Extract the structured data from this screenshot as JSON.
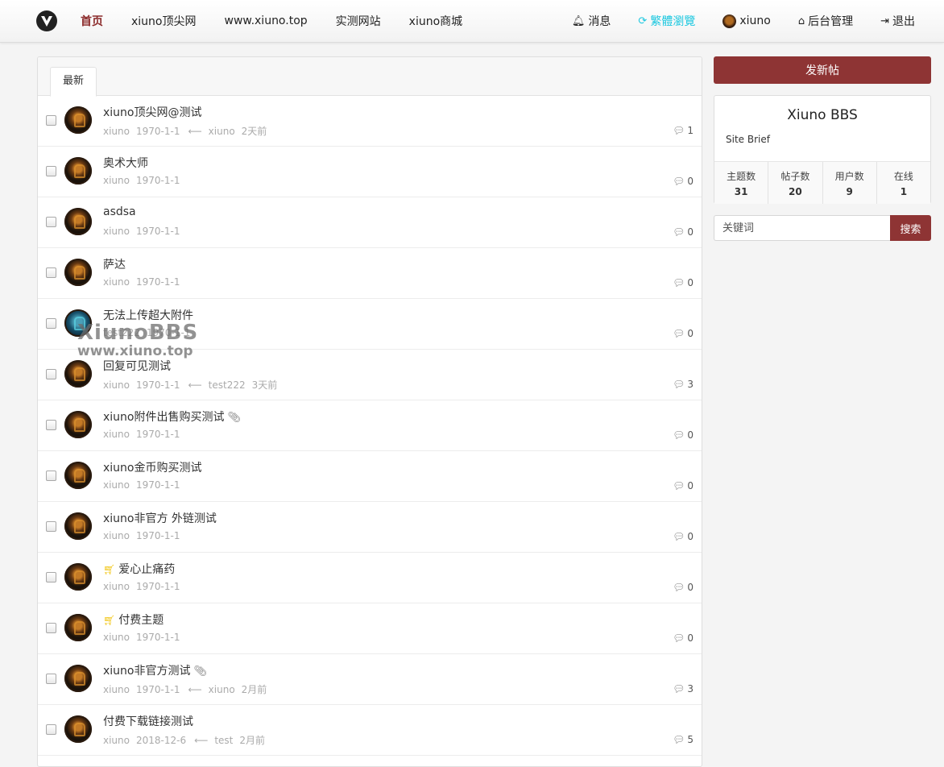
{
  "nav": {
    "left": [
      {
        "label": "首页",
        "active": true
      },
      {
        "label": "xiuno顶尖网"
      },
      {
        "label": "www.xiuno.top"
      },
      {
        "label": "实测网站"
      },
      {
        "label": "xiuno商城"
      }
    ],
    "right": {
      "messages": "消息",
      "traditional": "繁體瀏覽",
      "user": "xiuno",
      "admin": "后台管理",
      "logout": "退出"
    }
  },
  "tabs": {
    "latest": "最新"
  },
  "threads": [
    {
      "title": "xiuno顶尖网@测试",
      "author": "xiuno",
      "date": "1970-1-1",
      "last_user": "xiuno",
      "last_time": "2天前",
      "replies": "1",
      "cart": false,
      "attach": false,
      "avatar": "spartan"
    },
    {
      "title": "奥术大师",
      "author": "xiuno",
      "date": "1970-1-1",
      "replies": "0",
      "cart": false,
      "attach": false,
      "avatar": "spartan"
    },
    {
      "title": "asdsa",
      "author": "xiuno",
      "date": "1970-1-1",
      "replies": "0",
      "cart": false,
      "attach": false,
      "avatar": "spartan"
    },
    {
      "title": "萨达",
      "author": "xiuno",
      "date": "1970-1-1",
      "replies": "0",
      "cart": false,
      "attach": false,
      "avatar": "spartan"
    },
    {
      "title": "无法上传超大附件",
      "author": "test222",
      "date": "1970-1-1",
      "replies": "0",
      "cart": false,
      "attach": false,
      "avatar": "teal"
    },
    {
      "title": "回复可见测试",
      "author": "xiuno",
      "date": "1970-1-1",
      "last_user": "test222",
      "last_time": "3天前",
      "replies": "3",
      "cart": false,
      "attach": false,
      "avatar": "spartan"
    },
    {
      "title": "xiuno附件出售购买测试",
      "author": "xiuno",
      "date": "1970-1-1",
      "replies": "0",
      "cart": false,
      "attach": true,
      "avatar": "spartan"
    },
    {
      "title": "xiuno金币购买测试",
      "author": "xiuno",
      "date": "1970-1-1",
      "replies": "0",
      "cart": false,
      "attach": false,
      "avatar": "spartan"
    },
    {
      "title": "xiuno非官方 外链测试",
      "author": "xiuno",
      "date": "1970-1-1",
      "replies": "0",
      "cart": false,
      "attach": false,
      "avatar": "spartan"
    },
    {
      "title": "爱心止痛药",
      "author": "xiuno",
      "date": "1970-1-1",
      "replies": "0",
      "cart": true,
      "attach": false,
      "avatar": "spartan"
    },
    {
      "title": "付费主题",
      "author": "xiuno",
      "date": "1970-1-1",
      "replies": "0",
      "cart": true,
      "attach": false,
      "avatar": "spartan"
    },
    {
      "title": "xiuno非官方测试",
      "author": "xiuno",
      "date": "1970-1-1",
      "last_user": "xiuno",
      "last_time": "2月前",
      "replies": "3",
      "cart": false,
      "attach": true,
      "avatar": "spartan"
    },
    {
      "title": "付费下载链接测试",
      "author": "xiuno",
      "date": "2018-12-6",
      "last_user": "test",
      "last_time": "2月前",
      "replies": "5",
      "cart": false,
      "attach": false,
      "avatar": "spartan"
    }
  ],
  "watermark": {
    "line1": "XiunoBBS",
    "line2": "www.xiuno.top"
  },
  "sidebar": {
    "new_post": "发新帖",
    "site_name": "Xiuno BBS",
    "site_brief": "Site Brief",
    "stats": [
      {
        "label": "主题数",
        "value": "31"
      },
      {
        "label": "帖子数",
        "value": "20"
      },
      {
        "label": "用户数",
        "value": "9"
      },
      {
        "label": "在线",
        "value": "1"
      }
    ],
    "search_placeholder": "关键词",
    "search_button": "搜索"
  },
  "colors": {
    "brand": "#8e3434",
    "traditional_link": "#1ec8e0",
    "cart_icon": "#f1c40f"
  }
}
